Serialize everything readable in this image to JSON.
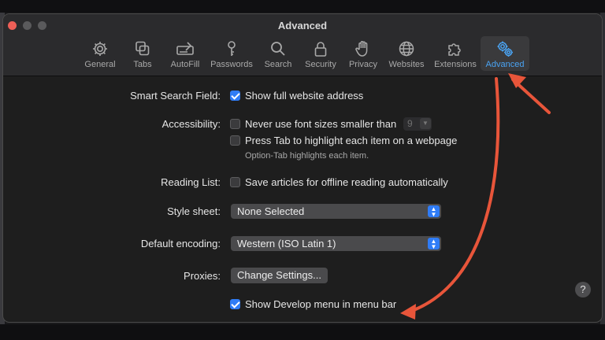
{
  "window": {
    "title": "Advanced"
  },
  "tabs": [
    {
      "label": "General",
      "icon": "gear-icon"
    },
    {
      "label": "Tabs",
      "icon": "tabs-icon"
    },
    {
      "label": "AutoFill",
      "icon": "autofill-icon"
    },
    {
      "label": "Passwords",
      "icon": "key-icon"
    },
    {
      "label": "Search",
      "icon": "magnifier-icon"
    },
    {
      "label": "Security",
      "icon": "lock-icon"
    },
    {
      "label": "Privacy",
      "icon": "hand-icon"
    },
    {
      "label": "Websites",
      "icon": "globe-icon"
    },
    {
      "label": "Extensions",
      "icon": "puzzle-icon"
    },
    {
      "label": "Advanced",
      "icon": "gears-icon",
      "active": true
    }
  ],
  "settings": {
    "smart_search": {
      "label": "Smart Search Field:",
      "option": "Show full website address",
      "checked": true
    },
    "accessibility": {
      "label": "Accessibility:",
      "option1": "Never use font sizes smaller than",
      "min_font_size": "9",
      "option2": "Press Tab to highlight each item on a webpage",
      "hint": "Option-Tab highlights each item."
    },
    "reading_list": {
      "label": "Reading List:",
      "option": "Save articles for offline reading automatically"
    },
    "style_sheet": {
      "label": "Style sheet:",
      "value": "None Selected"
    },
    "encoding": {
      "label": "Default encoding:",
      "value": "Western (ISO Latin 1)"
    },
    "proxies": {
      "label": "Proxies:",
      "button": "Change Settings..."
    },
    "develop_menu": {
      "option": "Show Develop menu in menu bar",
      "checked": true
    }
  },
  "help": {
    "label": "?"
  },
  "colors": {
    "accent": "#2f7cf6",
    "active_tab": "#4aa3f2",
    "annotation": "#e8553a"
  }
}
